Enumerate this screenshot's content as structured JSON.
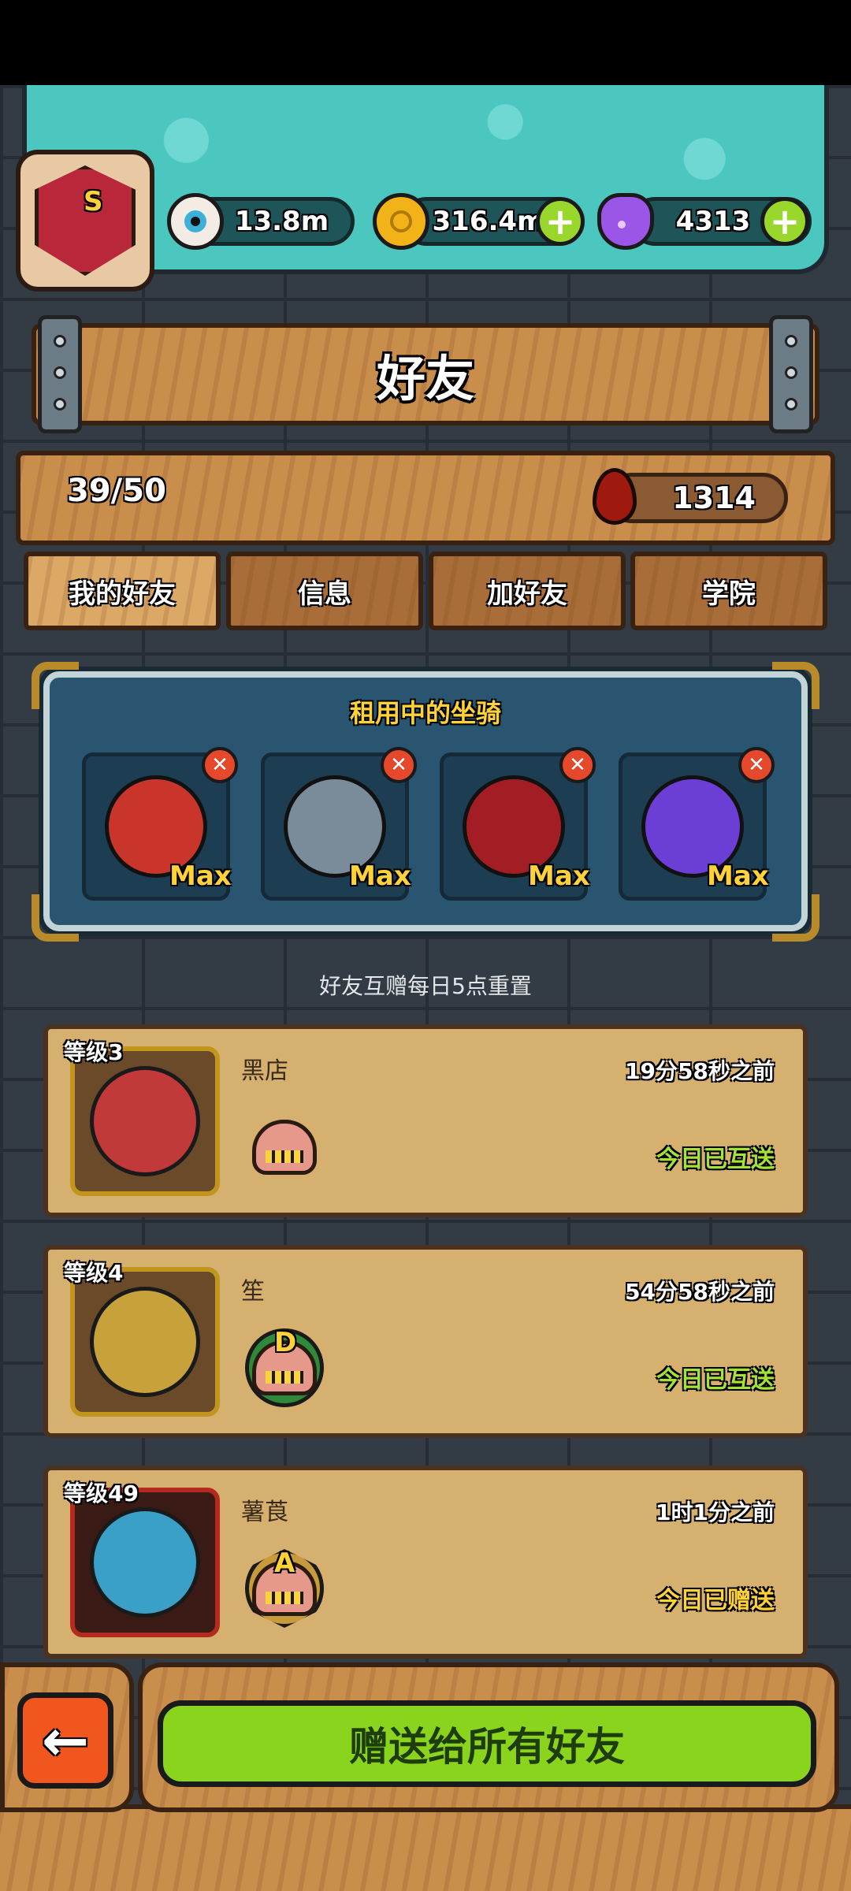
{
  "resources": {
    "eyes": "13.8m",
    "coins": "316.4m",
    "potions": "4313"
  },
  "profile": {
    "grade": "S"
  },
  "title": "好友",
  "stats": {
    "friend_count": "39/50",
    "blood": "1314"
  },
  "tabs": [
    {
      "label": "我的好友",
      "active": true
    },
    {
      "label": "信息",
      "active": false
    },
    {
      "label": "加好友",
      "active": false
    },
    {
      "label": "学院",
      "active": false
    }
  ],
  "rented_mounts": {
    "title": "租用中的坐骑",
    "items": [
      {
        "level": "Max",
        "icon": "lion-dance-mount-icon",
        "color": "#c9352a"
      },
      {
        "level": "Max",
        "icon": "mech-cannon-mount-icon",
        "color": "#7a8b99"
      },
      {
        "level": "Max",
        "icon": "horned-demon-mount-icon",
        "color": "#a31e24"
      },
      {
        "level": "Max",
        "icon": "purple-rose-mount-icon",
        "color": "#6b3ed6"
      }
    ]
  },
  "reset_note": "好友互赠每日5点重置",
  "friends": [
    {
      "level": "等级3",
      "name": "黑店",
      "time": "19分58秒之前",
      "status": "今日已互送",
      "grade": "",
      "portrait_color": "#c2393a"
    },
    {
      "level": "等级4",
      "name": "笙",
      "time": "54分58秒之前",
      "status": "今日已互送",
      "grade": "D",
      "portrait_color": "#c7a23a"
    },
    {
      "level": "等级49",
      "name": "薯莨",
      "time": "1时1分之前",
      "status": "今日已赠送",
      "grade": "A",
      "portrait_color": "#3aa0c7"
    }
  ],
  "actions": {
    "back": "←",
    "send_all": "赠送给所有好友"
  }
}
